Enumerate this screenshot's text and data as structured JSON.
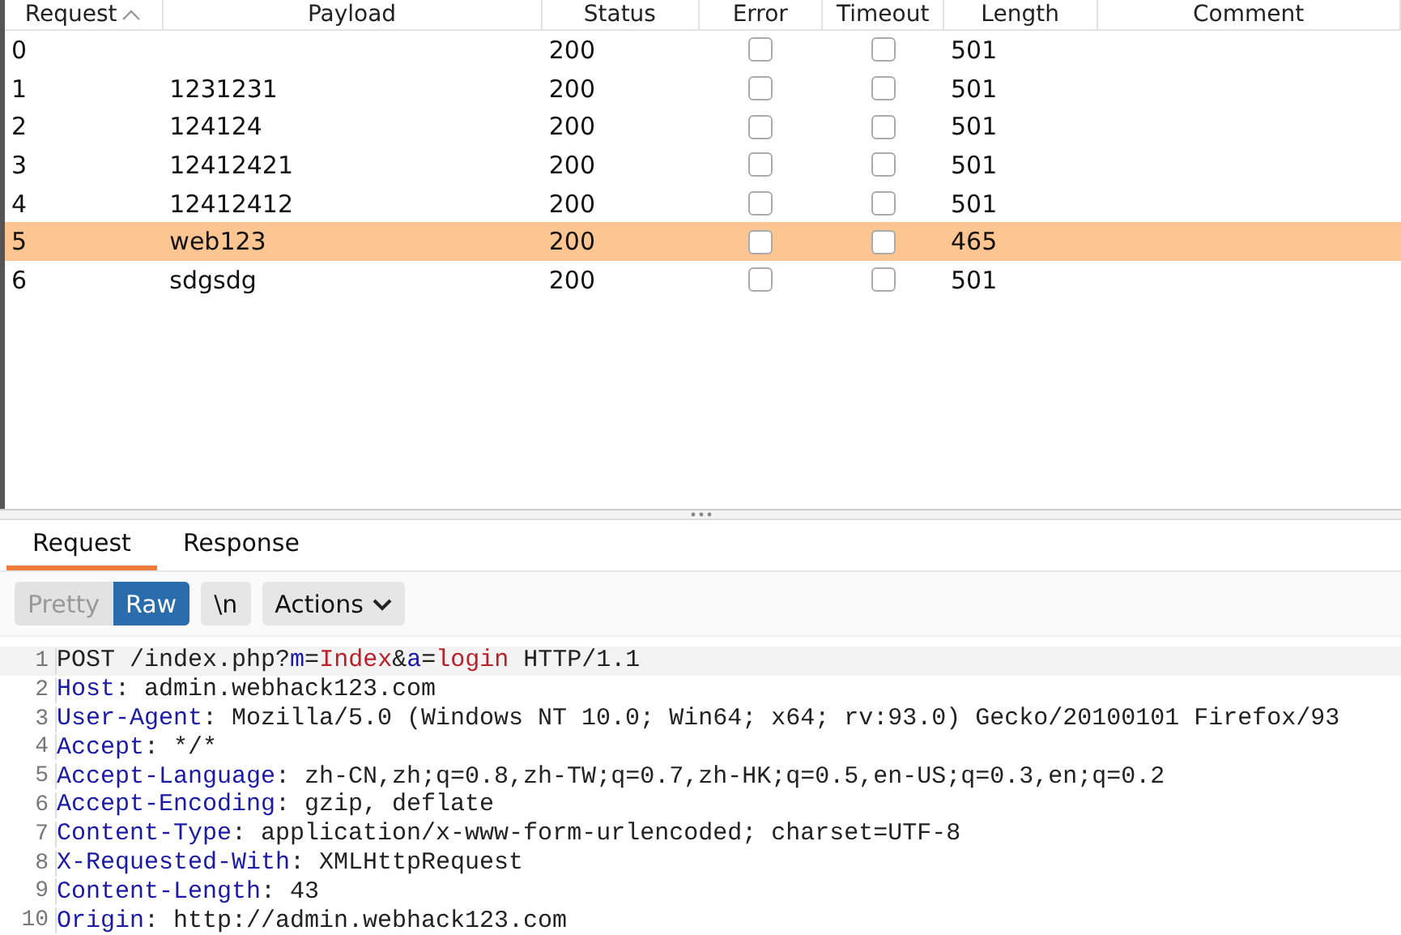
{
  "table": {
    "columns": [
      {
        "label": "Request",
        "sorted": true
      },
      {
        "label": "Payload",
        "sorted": false
      },
      {
        "label": "Status",
        "sorted": false
      },
      {
        "label": "Error",
        "sorted": false
      },
      {
        "label": "Timeout",
        "sorted": false
      },
      {
        "label": "Length",
        "sorted": false
      },
      {
        "label": "Comment",
        "sorted": false
      }
    ],
    "rows": [
      {
        "request": "0",
        "status": "200",
        "error": false,
        "timeout": false,
        "length": "501",
        "selected": false
      },
      {
        "request": "1",
        "payload": "1231231",
        "status": "200",
        "error": false,
        "timeout": false,
        "length": "501",
        "selected": false
      },
      {
        "request": "2",
        "payload": "124124",
        "status": "200",
        "error": false,
        "timeout": false,
        "length": "501",
        "selected": false
      },
      {
        "request": "3",
        "payload": "12412421",
        "status": "200",
        "error": false,
        "timeout": false,
        "length": "501",
        "selected": false
      },
      {
        "request": "4",
        "payload": "12412412",
        "status": "200",
        "error": false,
        "timeout": false,
        "length": "501",
        "selected": false
      },
      {
        "request": "5",
        "payload": "web123",
        "status": "200",
        "error": false,
        "timeout": false,
        "length": "465",
        "selected": true
      },
      {
        "request": "6",
        "payload": "sdgsdg",
        "status": "200",
        "error": false,
        "timeout": false,
        "length": "501",
        "selected": false
      }
    ]
  },
  "tabs": [
    {
      "label": "Request",
      "selected": true
    },
    {
      "label": "Response",
      "selected": false
    }
  ],
  "toolbar": {
    "view_modes": [
      {
        "label": "Pretty",
        "selected": false
      },
      {
        "label": "Raw",
        "selected": true
      }
    ],
    "newline_button": "\\n",
    "actions_button": "Actions"
  },
  "editor": {
    "lines": [
      {
        "number": "1",
        "segments": [
          {
            "kind": "plain",
            "text": "POST /index.php?"
          },
          {
            "kind": "name",
            "text": "m"
          },
          {
            "kind": "plain",
            "text": "="
          },
          {
            "kind": "value",
            "text": "Index"
          },
          {
            "kind": "plain",
            "text": "&"
          },
          {
            "kind": "name",
            "text": "a"
          },
          {
            "kind": "plain",
            "text": "="
          },
          {
            "kind": "value",
            "text": "login"
          },
          {
            "kind": "plain",
            "text": " HTTP/1.1"
          }
        ]
      },
      {
        "number": "2",
        "segments": [
          {
            "kind": "name",
            "text": "Host"
          },
          {
            "kind": "plain",
            "text": ": admin.webhack123.com"
          }
        ]
      },
      {
        "number": "3",
        "segments": [
          {
            "kind": "name",
            "text": "User-Agent"
          },
          {
            "kind": "plain",
            "text": ": Mozilla/5.0 (Windows NT 10.0; Win64; x64; rv:93.0) Gecko/20100101 Firefox/93"
          }
        ]
      },
      {
        "number": "4",
        "segments": [
          {
            "kind": "name",
            "text": "Accept"
          },
          {
            "kind": "plain",
            "text": ": */*"
          }
        ]
      },
      {
        "number": "5",
        "segments": [
          {
            "kind": "name",
            "text": "Accept-Language"
          },
          {
            "kind": "plain",
            "text": ": zh-CN,zh;q=0.8,zh-TW;q=0.7,zh-HK;q=0.5,en-US;q=0.3,en;q=0.2"
          }
        ]
      },
      {
        "number": "6",
        "segments": [
          {
            "kind": "name",
            "text": "Accept-Encoding"
          },
          {
            "kind": "plain",
            "text": ": gzip, deflate"
          }
        ]
      },
      {
        "number": "7",
        "segments": [
          {
            "kind": "name",
            "text": "Content-Type"
          },
          {
            "kind": "plain",
            "text": ": application/x-www-form-urlencoded; charset=UTF-8"
          }
        ]
      },
      {
        "number": "8",
        "segments": [
          {
            "kind": "name",
            "text": "X-Requested-With"
          },
          {
            "kind": "plain",
            "text": ": XMLHttpRequest"
          }
        ]
      },
      {
        "number": "9",
        "segments": [
          {
            "kind": "name",
            "text": "Content-Length"
          },
          {
            "kind": "plain",
            "text": ": 43"
          }
        ]
      },
      {
        "number": "10",
        "segments": [
          {
            "kind": "name",
            "text": "Origin"
          },
          {
            "kind": "plain",
            "text": ": http://admin.webhack123.com"
          }
        ]
      }
    ]
  }
}
